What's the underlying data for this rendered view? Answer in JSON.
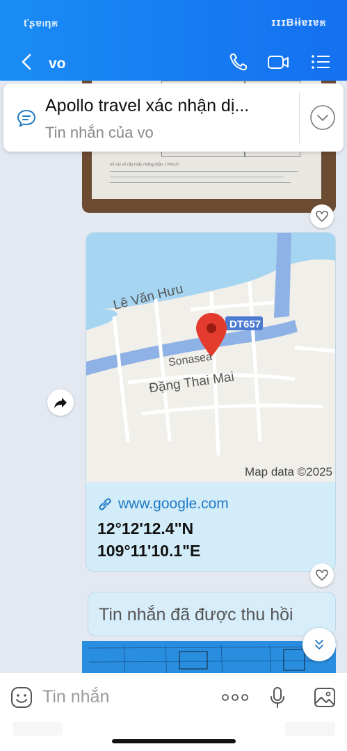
{
  "status": {
    "left": "ťʂɐ၊ƞ೫",
    "right": "ɪɪɪBɨɨɐɪɐ೫"
  },
  "header": {
    "title": "vo",
    "icons": [
      "back-icon",
      "phone-icon",
      "video-icon",
      "menu-icon"
    ]
  },
  "pinned": {
    "title": "Apollo travel xác nhận dị...",
    "subtitle": "Tin nhắn của vo"
  },
  "paper": {
    "line1": "Số vào sổ cấp Giấy chứng nhận: CN6125"
  },
  "map": {
    "road1": "Lê Văn Hưu",
    "road2": "Đặng Thai Mai",
    "road3": "Sonasea",
    "route_badge": "DT657",
    "credit": "Map data ©2025"
  },
  "link": {
    "url": "www.google.com",
    "lat": "12°12'12.4\"N",
    "lng": "109°11'10.1\"E"
  },
  "recalled": "Tin nhắn đã được thu hồi",
  "composer": {
    "placeholder": "Tin nhắn"
  },
  "colors": {
    "header_start": "#1a8cf5",
    "header_end": "#1470f0",
    "accent": "#1f7ac4",
    "pin_red": "#e33b2e"
  }
}
